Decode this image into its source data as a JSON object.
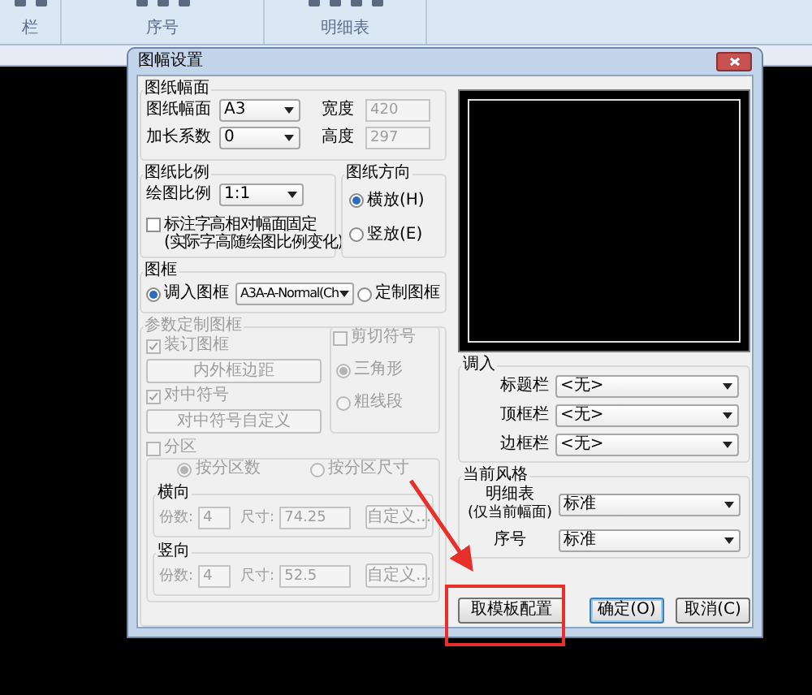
{
  "ribbon": {
    "groups": [
      {
        "label": "栏"
      },
      {
        "label": "序号"
      },
      {
        "label": "明细表"
      }
    ]
  },
  "dialog": {
    "title": "图幅设置",
    "paper": {
      "title": "图纸幅面",
      "rows": [
        {
          "label": "图纸幅面",
          "value": "A3",
          "dim_label": "宽度",
          "dim_value": "420"
        },
        {
          "label": "加长系数",
          "value": "0",
          "dim_label": "高度",
          "dim_value": "297"
        }
      ]
    },
    "scale": {
      "title": "图纸比例",
      "label": "绘图比例",
      "value": "1:1",
      "checkbox": {
        "label": "标注字高相对幅面固定",
        "note": "(实际字高随绘图比例变化)",
        "checked": false
      }
    },
    "orientation": {
      "title": "图纸方向",
      "options": [
        {
          "label": "横放(H)",
          "selected": true
        },
        {
          "label": "竖放(E)",
          "selected": false
        }
      ]
    },
    "frame": {
      "title": "图框",
      "load": {
        "label": "调入图框",
        "selected": true
      },
      "template": "A3A-A-Normal(Ch",
      "custom": {
        "label": "定制图框",
        "selected": false
      }
    },
    "param_frame": {
      "title": "参数定制图框",
      "disabled": true,
      "binding": {
        "label": "装订图框",
        "checked": true
      },
      "margin_button": "内外框边距",
      "center": {
        "label": "对中符号",
        "checked": true
      },
      "center_button": "对中符号自定义",
      "cut": {
        "label": "剪切符号",
        "checked": false,
        "options": [
          {
            "label": "三角形",
            "selected": true
          },
          {
            "label": "粗线段",
            "selected": false
          }
        ]
      },
      "zones": {
        "label": "分区",
        "checked": false,
        "modes": [
          {
            "label": "按分区数",
            "selected": true
          },
          {
            "label": "按分区尺寸",
            "selected": false
          }
        ],
        "directions": [
          {
            "title": "横向",
            "count_label": "份数:",
            "count": "4",
            "size_label": "尺寸:",
            "size": "74.25",
            "button": "自定义..."
          },
          {
            "title": "竖向",
            "count_label": "份数:",
            "count": "4",
            "size_label": "尺寸:",
            "size": "52.5",
            "button": "自定义..."
          }
        ]
      }
    },
    "load": {
      "title": "调入",
      "rows": [
        {
          "label": "标题栏",
          "value": "<无>"
        },
        {
          "label": "顶框栏",
          "value": "<无>"
        },
        {
          "label": "边框栏",
          "value": "<无>"
        }
      ]
    },
    "style": {
      "title": "当前风格",
      "rows": [
        {
          "label": "明细表",
          "note": "(仅当前幅面)",
          "value": "标准"
        },
        {
          "label": "序号",
          "value": "标准"
        }
      ]
    },
    "buttons": [
      {
        "label": "取模板配置",
        "kind": "plain"
      },
      {
        "label": "确定(O)",
        "kind": "default"
      },
      {
        "label": "取消(C)",
        "kind": "plain"
      }
    ]
  }
}
